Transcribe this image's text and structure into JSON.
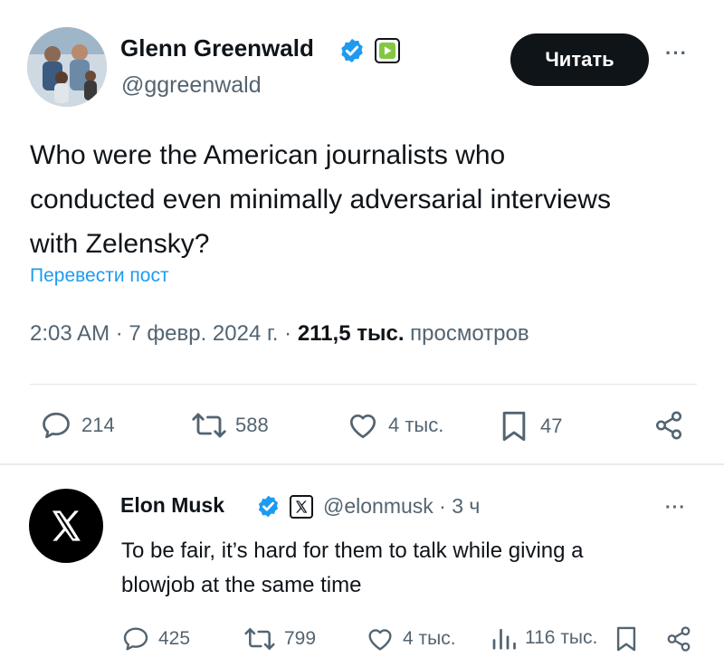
{
  "tweet": {
    "author_name": "Glenn Greenwald",
    "author_handle": "@ggreenwald",
    "follow_label": "Читать",
    "more_label": "···",
    "text_lines": [
      "Who were the American journalists who",
      "conducted even minimally adversarial interviews",
      "with Zelensky?"
    ],
    "translate_label": "Перевести пост",
    "time": "2:03 AM · 7 февр. 2024 г. · ",
    "views_count": "211,5 тыс.",
    "views_label": " просмотров",
    "actions": {
      "replies": "214",
      "retweets": "588",
      "likes": "4 тыс.",
      "bookmarks": "47"
    }
  },
  "reply": {
    "author_name": "Elon Musk",
    "author_handle": "@elonmusk · 3 ч",
    "more_label": "···",
    "text_lines": [
      "To be fair, it’s hard for them to talk while giving a",
      "blowjob at the same time"
    ],
    "actions": {
      "replies": "425",
      "retweets": "799",
      "likes": "4 тыс.",
      "views": "116 тыс."
    }
  },
  "colors": {
    "accent": "#1d9bf0",
    "text_primary": "#0f1419",
    "text_secondary": "#536471",
    "verified": "#1d9bf0",
    "rumble_green": "#85c742"
  },
  "icons": [
    "reply-icon",
    "retweet-icon",
    "like-icon",
    "bookmark-icon",
    "share-icon",
    "views-icon",
    "verified-icon",
    "x-logo-icon"
  ]
}
